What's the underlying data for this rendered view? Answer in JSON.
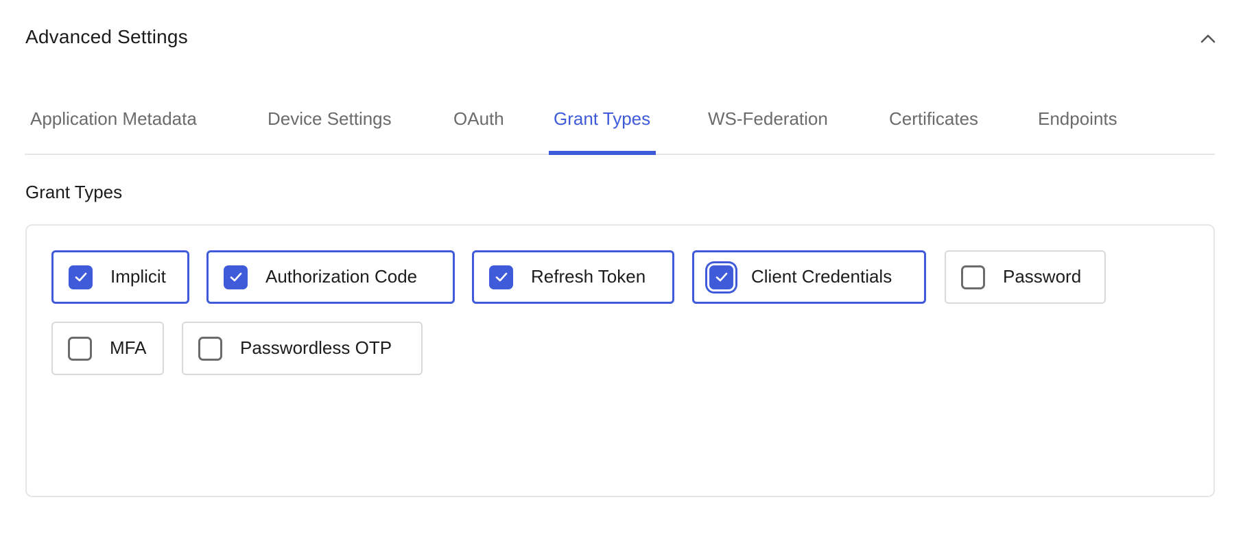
{
  "header": {
    "title": "Advanced Settings",
    "collapse_icon": "chevron-up-icon"
  },
  "tabs": [
    {
      "label": "Application Metadata",
      "active": false
    },
    {
      "label": "Device Settings",
      "active": false
    },
    {
      "label": "OAuth",
      "active": false
    },
    {
      "label": "Grant Types",
      "active": true
    },
    {
      "label": "WS-Federation",
      "active": false
    },
    {
      "label": "Certificates",
      "active": false
    },
    {
      "label": "Endpoints",
      "active": false
    }
  ],
  "section": {
    "label": "Grant Types"
  },
  "grant_types": [
    {
      "label": "Implicit",
      "checked": true,
      "focused": false
    },
    {
      "label": "Authorization Code",
      "checked": true,
      "focused": false
    },
    {
      "label": "Refresh Token",
      "checked": true,
      "focused": false
    },
    {
      "label": "Client Credentials",
      "checked": true,
      "focused": true
    },
    {
      "label": "Password",
      "checked": false,
      "focused": false
    },
    {
      "label": "MFA",
      "checked": false,
      "focused": false
    },
    {
      "label": "Passwordless OTP",
      "checked": false,
      "focused": false
    }
  ],
  "colors": {
    "accent": "#3f5bd9",
    "tab_inactive": "#6b6b6b",
    "text": "#1c1c1c",
    "border": "#e6e6e6",
    "checkbox_unchecked": "#6b6b6b"
  }
}
